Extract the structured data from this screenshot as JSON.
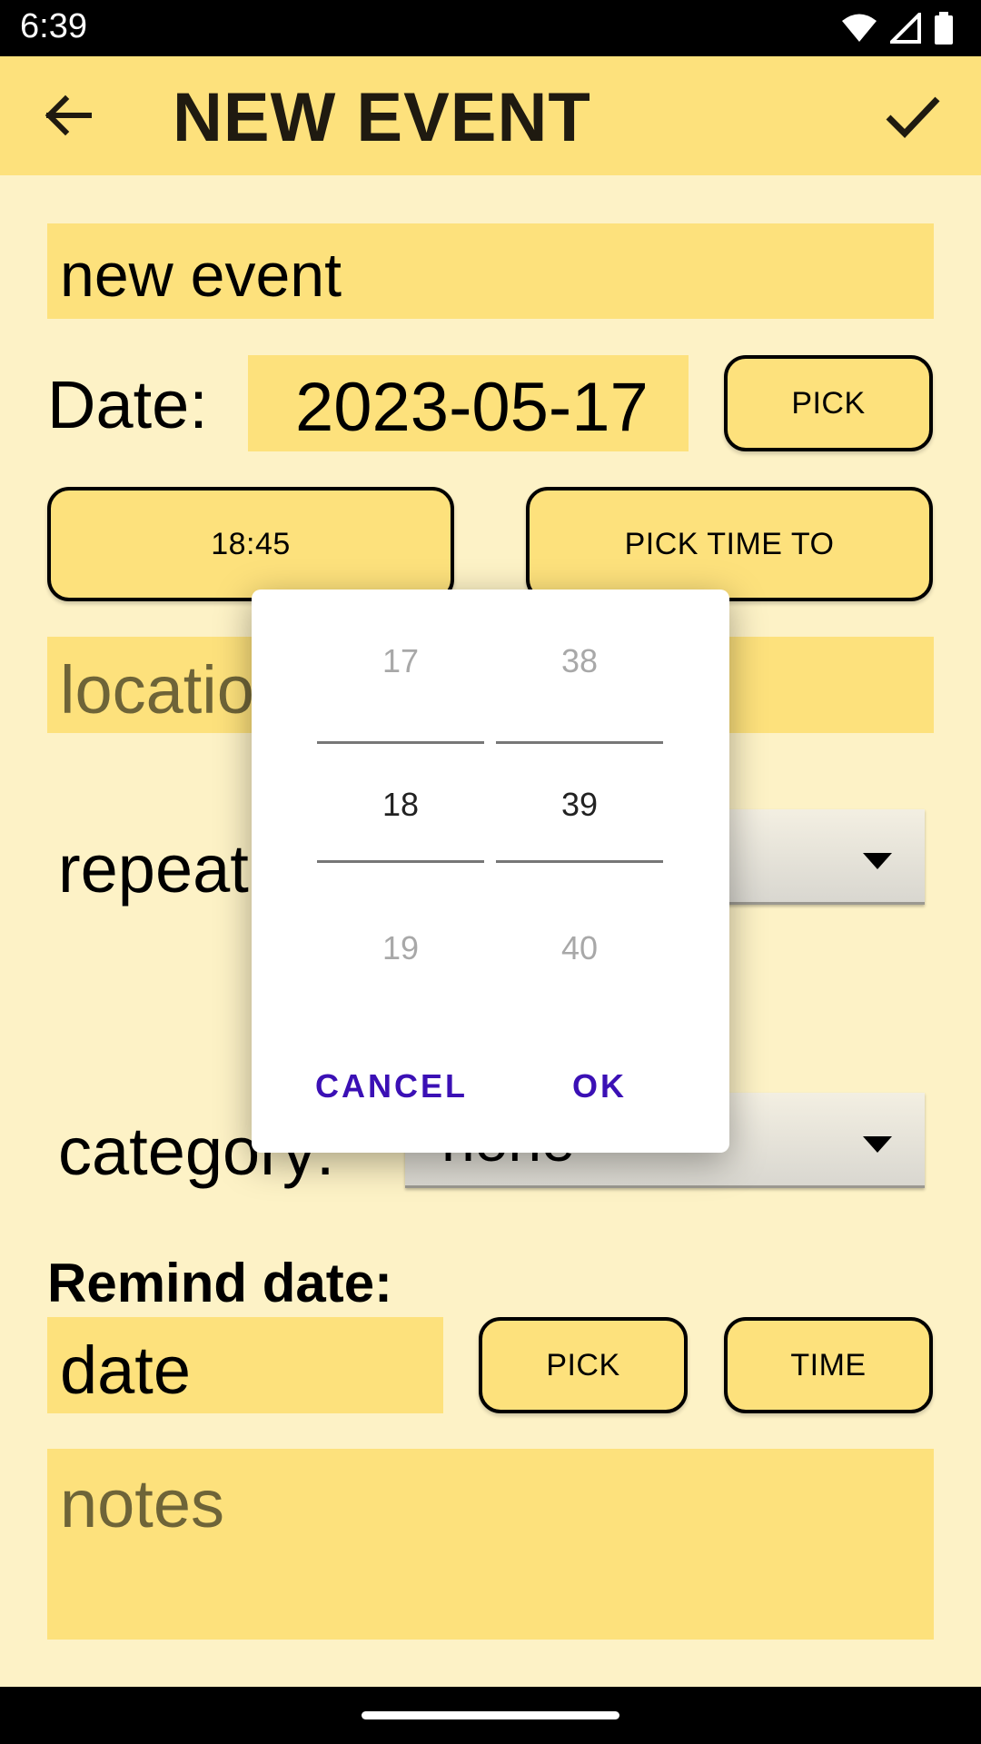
{
  "status": {
    "time": "6:39"
  },
  "app_bar": {
    "title": "NEW EVENT"
  },
  "form": {
    "title_value": "new event",
    "date_label": "Date:",
    "date_value": "2023-05-17",
    "date_pick_label": "PICK",
    "time_from_label": "18:45",
    "time_to_label": "PICK TIME TO",
    "location_placeholder": "location",
    "repeat_label": "repeat:",
    "category_label": "category:",
    "category_value": "none",
    "remind_label": "Remind date:",
    "remind_date_value": "date",
    "remind_pick_label": "PICK",
    "remind_time_label": "TIME",
    "notes_placeholder": "notes"
  },
  "time_picker": {
    "hours": {
      "prev": "17",
      "selected": "18",
      "next": "19"
    },
    "minutes": {
      "prev": "38",
      "selected": "39",
      "next": "40"
    },
    "cancel_label": "CANCEL",
    "ok_label": "OK"
  },
  "icons": [
    "back-arrow-icon",
    "checkmark-icon",
    "wifi-icon",
    "signal-icon",
    "battery-icon",
    "dropdown-arrow-icon"
  ],
  "colors": {
    "background": "#fdf2c6",
    "accent": "#fde17c",
    "dialog_button": "#3b10b5"
  }
}
